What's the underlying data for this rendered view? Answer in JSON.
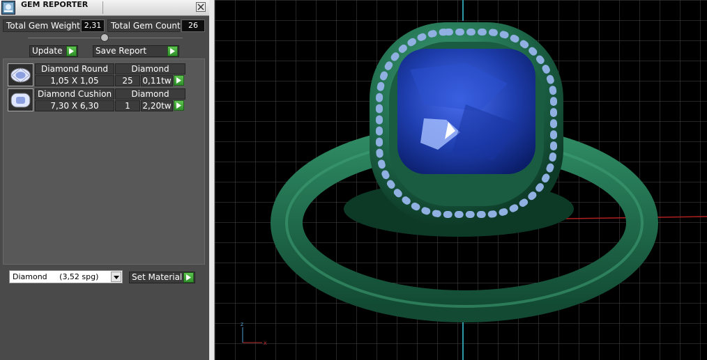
{
  "window": {
    "title": "GEM REPORTER",
    "icon": "gem-reporter-icon"
  },
  "totals": {
    "weight_label": "Total Gem Weight",
    "weight_value": "2,31",
    "count_label": "Total Gem Count",
    "count_value": "26"
  },
  "actions": {
    "update_label": "Update",
    "save_label": "Save Report"
  },
  "gems": [
    {
      "name": "Diamond Round",
      "material": "Diamond",
      "size": "1,05 X 1,05",
      "count": "25",
      "weight": "0,11tw",
      "icon": "round-gem-icon"
    },
    {
      "name": "Diamond Cushion",
      "material": "Diamond",
      "size": "7,30 X 6,30",
      "count": "1",
      "weight": "2,20tw",
      "icon": "cushion-gem-icon"
    }
  ],
  "material": {
    "selected": "Diamond     (3,52 spg)",
    "set_label": "Set Material"
  },
  "colors": {
    "panel": "#4a4a4a",
    "accent_green": "#3aa83a",
    "ring_metal": "#1f6b4c",
    "gem_blue": "#1f3fb0",
    "viewport_bg": "#000000",
    "grid": "#4a4a4a"
  }
}
